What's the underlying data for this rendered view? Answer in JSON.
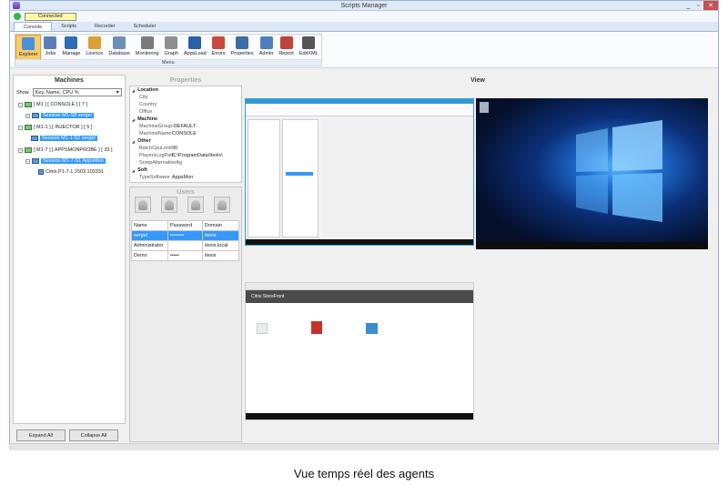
{
  "window": {
    "title": "Scripts Manager",
    "minimize": "_",
    "maximize": "▫",
    "close": "✕"
  },
  "status": {
    "label": "Connected"
  },
  "tabs": [
    "Console",
    "Scripts",
    "Recorder",
    "Scheduler"
  ],
  "ribbon": {
    "group_label": "Menu",
    "buttons": [
      {
        "label": "Explorer",
        "color": "#4a90d9"
      },
      {
        "label": "Jobs",
        "color": "#5a7fb5"
      },
      {
        "label": "Manage",
        "color": "#2f6db5"
      },
      {
        "label": "Licence",
        "color": "#d9a235"
      },
      {
        "label": "Database",
        "color": "#6b8fb8"
      },
      {
        "label": "Monitoring",
        "color": "#7a7a7a"
      },
      {
        "label": "Graph",
        "color": "#8f8f8f"
      },
      {
        "label": "AppsLoad",
        "color": "#2b5fa8"
      },
      {
        "label": "Errors",
        "color": "#c94a3b"
      },
      {
        "label": "Properties",
        "color": "#3a6ea5"
      },
      {
        "label": "Admin",
        "color": "#4d7fbf"
      },
      {
        "label": "Report",
        "color": "#c0443a"
      },
      {
        "label": "EditXML",
        "color": "#555555"
      }
    ]
  },
  "machines": {
    "title": "Machines",
    "show_label": "Show",
    "show_value": "Key, Name, CPU %",
    "tree": [
      {
        "label": "[ M1 ] [ CONSOLE ] [ 7 ]",
        "kind": "machine"
      },
      {
        "label": "Session M1-S8 sergel",
        "kind": "session"
      },
      {
        "label": "[ M1-1 ] [ INJECTOR ] [ 5 ]",
        "kind": "machine"
      },
      {
        "label": "Session M1-1-S2 sergel",
        "kind": "session"
      },
      {
        "label": "[ M1-7 ] [ APPSMONPROBE ] [ 33 ]",
        "kind": "machine"
      },
      {
        "label": "Session M1-7-S1 AppsMon",
        "kind": "session"
      },
      {
        "label": "Citrix.P1-7.1.1503.103331",
        "kind": "app"
      }
    ],
    "expand_all": "Expand All",
    "collapse_all": "Collapse All"
  },
  "properties": {
    "title": "Properties",
    "sections": [
      {
        "name": "Location",
        "rows": [
          {
            "k": "City",
            "v": ""
          },
          {
            "k": "Country",
            "v": ""
          },
          {
            "k": "Office",
            "v": ""
          }
        ]
      },
      {
        "name": "Machine",
        "rows": [
          {
            "k": "MachineGroup",
            "v": "-DEFAULT-"
          },
          {
            "k": "MachineName",
            "v": "CONSOLE"
          }
        ]
      },
      {
        "name": "Other",
        "rows": [
          {
            "k": "BatchCpuLimit",
            "v": "90"
          },
          {
            "k": "PlayersLogPath",
            "v": "C:\\ProgramData\\Itexis\\"
          },
          {
            "k": "SnmpAlternativeAg",
            "v": ""
          }
        ]
      },
      {
        "name": "Soft",
        "rows": [
          {
            "k": "TypeSoftware",
            "v": "AppsMon"
          }
        ]
      }
    ]
  },
  "users": {
    "title": "Users",
    "columns": [
      "Name",
      "Password",
      "Domain"
    ],
    "rows": [
      {
        "name": "sergel",
        "password": "••••••••",
        "domain": "itexis"
      },
      {
        "name": "Administrator",
        "password": "",
        "domain": "itexis.local"
      },
      {
        "name": "Demo",
        "password": "•••••",
        "domain": "itexis"
      }
    ]
  },
  "view": {
    "title": "View",
    "storefront_title": "Citrix StoreFront"
  },
  "caption": "Vue temps réel des agents"
}
